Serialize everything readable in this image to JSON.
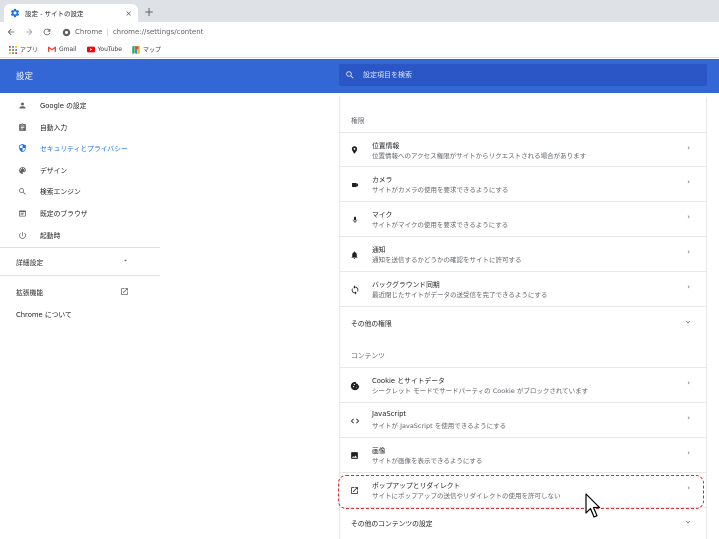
{
  "browser": {
    "tab_title": "設定 - サイトの設定",
    "tab_close": "×",
    "new_tab": "+",
    "site_label": "Chrome",
    "separator": "|",
    "url": "chrome://settings/content",
    "bookmarks": [
      {
        "label": "アプリ",
        "icon": "apps-icon"
      },
      {
        "label": "Gmail",
        "icon": "gmail-icon"
      },
      {
        "label": "YouTube",
        "icon": "youtube-icon"
      },
      {
        "label": "マップ",
        "icon": "maps-icon"
      }
    ]
  },
  "header": {
    "title": "設定",
    "search_placeholder": "設定項目を検索"
  },
  "sidebar": {
    "items": [
      {
        "label": "Google の設定",
        "icon": "person-icon"
      },
      {
        "label": "自動入力",
        "icon": "clipboard-icon"
      },
      {
        "label": "セキュリティとプライバシー",
        "icon": "shield-icon",
        "active": true
      },
      {
        "label": "デザイン",
        "icon": "palette-icon"
      },
      {
        "label": "検索エンジン",
        "icon": "search-icon"
      },
      {
        "label": "既定のブラウザ",
        "icon": "browser-icon"
      },
      {
        "label": "起動時",
        "icon": "power-icon"
      }
    ],
    "advanced": "詳細設定",
    "extensions": "拡張機能",
    "about": "Chrome について"
  },
  "content": {
    "permissions_title": "権限",
    "permissions": [
      {
        "title": "位置情報",
        "desc": "位置情報へのアクセス権限がサイトからリクエストされる場合があります",
        "icon": "location-icon"
      },
      {
        "title": "カメラ",
        "desc": "サイトがカメラの使用を要求できるようにする",
        "icon": "camera-icon"
      },
      {
        "title": "マイク",
        "desc": "サイトがマイクの使用を要求できるようにする",
        "icon": "mic-icon"
      },
      {
        "title": "通知",
        "desc": "通知を送信するかどうかの確認をサイトに許可する",
        "icon": "bell-icon"
      },
      {
        "title": "バックグラウンド同期",
        "desc": "最近閉じたサイトがデータの送受信を完了できるようにする",
        "icon": "sync-icon"
      }
    ],
    "more_permissions": "その他の権限",
    "content_title": "コンテンツ",
    "content_items": [
      {
        "title": "Cookie とサイトデータ",
        "desc": "シークレット モードでサードパーティの Cookie がブロックされています",
        "icon": "cookie-icon"
      },
      {
        "title": "JavaScript",
        "desc": "サイトが JavaScript を使用できるようにする",
        "icon": "code-icon"
      },
      {
        "title": "画像",
        "desc": "サイトが画像を表示できるようにする",
        "icon": "image-icon"
      },
      {
        "title": "ポップアップとリダイレクト",
        "desc": "サイトにポップアップの送信やリダイレクトの使用を許可しない",
        "icon": "open-in-new-icon"
      }
    ],
    "more_content": "その他のコンテンツの設定",
    "arrow": "›"
  },
  "colors": {
    "header_bg": "#3367d6",
    "accent": "#1a73e8",
    "highlight": "#d32f2f"
  }
}
